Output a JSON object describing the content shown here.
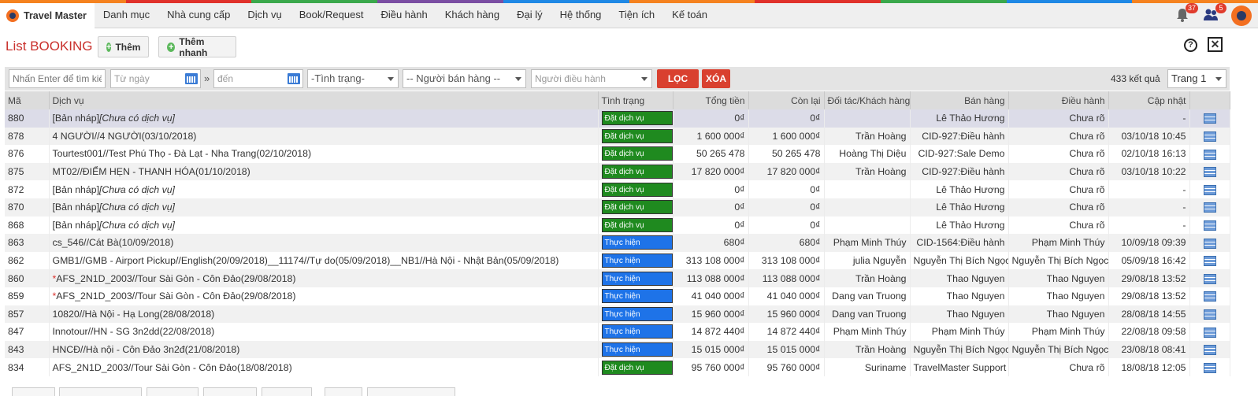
{
  "app": {
    "brand": "Travel Master"
  },
  "nav": [
    "Danh mục",
    "Nhà cung cấp",
    "Dịch vụ",
    "Book/Request",
    "Điều hành",
    "Khách hàng",
    "Đại lý",
    "Hệ thống",
    "Tiện ích",
    "Kế toán"
  ],
  "notifications": {
    "bell_count": "37",
    "users_count": "5"
  },
  "stripe_colors": [
    "#f5821f",
    "#e0312b",
    "#3aa84b",
    "#7b4ea3",
    "#1e88e5",
    "#f5821f",
    "#e0312b",
    "#3aa84b",
    "#1e88e5",
    "#f5821f"
  ],
  "page": {
    "title": "List BOOKING",
    "add_label": "Thêm",
    "quick_add_label": "Thêm nhanh",
    "help": "?",
    "close": "✕"
  },
  "filters": {
    "search_placeholder": "Nhấn Enter để tìm kiếm",
    "from_placeholder": "Từ ngày",
    "range_sep": "»",
    "to_placeholder": "đến",
    "status_select": "-Tình trạng-",
    "seller_select": "-- Người bán hàng --",
    "operator_select": "Người điều hành",
    "filter_button": "LỌC",
    "clear_button": "XÓA",
    "results": "433 kết quả",
    "page_select": "Trang 1"
  },
  "table": {
    "headers": [
      "Mã",
      "Dịch vụ",
      "Tình trạng",
      "Tổng tiền",
      "Còn lại",
      "Đối tác/Khách hàng",
      "Bán hàng",
      "Điều hành",
      "Cập nhật"
    ],
    "rows": [
      {
        "id": "880",
        "service_prefix": "",
        "service": "[Bản nháp]",
        "service_note": "[Chưa có dịch vụ]",
        "status": "Đặt dịch vụ",
        "status_color": "#1f8a1f",
        "total": "0₫",
        "remaining": "0₫",
        "partner": "",
        "seller": "Lê Thảo Hương",
        "operator": "Chưa rõ",
        "updated": "-"
      },
      {
        "id": "878",
        "service_prefix": "",
        "service": "4 NGƯỜI//4 NGƯỜI(03/10/2018)",
        "service_note": "",
        "status": "Đặt dịch vụ",
        "status_color": "#1f8a1f",
        "total": "1 600 000₫",
        "remaining": "1 600 000₫",
        "partner": "Trần Hoàng",
        "seller": "CID-927:Điều hành",
        "operator": "Chưa rõ",
        "updated": "03/10/18 10:45"
      },
      {
        "id": "876",
        "service_prefix": "",
        "service": "Tourtest001//Test Phú Thọ - Đà Lạt - Nha Trang(02/10/2018)",
        "service_note": "",
        "status": "Đặt dịch vụ",
        "status_color": "#1f8a1f",
        "total": "50 265 478",
        "remaining": "50 265 478",
        "partner": "Hoàng Thị Diệu",
        "seller": "CID-927:Sale Demo",
        "operator": "Chưa rõ",
        "updated": "02/10/18 16:13"
      },
      {
        "id": "875",
        "service_prefix": "",
        "service": "MT02//ĐIỂM HẸN - THANH HÓA(01/10/2018)",
        "service_note": "",
        "status": "Đặt dịch vụ",
        "status_color": "#1f8a1f",
        "total": "17 820 000₫",
        "remaining": "17 820 000₫",
        "partner": "Trần Hoàng",
        "seller": "CID-927:Điều hành",
        "operator": "Chưa rõ",
        "updated": "03/10/18 10:22"
      },
      {
        "id": "872",
        "service_prefix": "",
        "service": "[Bản nháp]",
        "service_note": "[Chưa có dịch vụ]",
        "status": "Đặt dịch vụ",
        "status_color": "#1f8a1f",
        "total": "0₫",
        "remaining": "0₫",
        "partner": "",
        "seller": "Lê Thảo Hương",
        "operator": "Chưa rõ",
        "updated": "-"
      },
      {
        "id": "870",
        "service_prefix": "",
        "service": "[Bản nháp]",
        "service_note": "[Chưa có dịch vụ]",
        "status": "Đặt dịch vụ",
        "status_color": "#1f8a1f",
        "total": "0₫",
        "remaining": "0₫",
        "partner": "",
        "seller": "Lê Thảo Hương",
        "operator": "Chưa rõ",
        "updated": "-"
      },
      {
        "id": "868",
        "service_prefix": "",
        "service": "[Bản nháp]",
        "service_note": "[Chưa có dịch vụ]",
        "status": "Đặt dịch vụ",
        "status_color": "#1f8a1f",
        "total": "0₫",
        "remaining": "0₫",
        "partner": "",
        "seller": "Lê Thảo Hương",
        "operator": "Chưa rõ",
        "updated": "-"
      },
      {
        "id": "863",
        "service_prefix": "",
        "service": "cs_546//Cát Bà(10/09/2018)",
        "service_note": "",
        "status": "Thực hiện",
        "status_color": "#1e73e8",
        "total": "680₫",
        "remaining": "680₫",
        "partner": "Phạm Minh Thúy",
        "seller": "CID-1564:Điều hành",
        "operator": "Phạm Minh Thúy",
        "updated": "10/09/18 09:39"
      },
      {
        "id": "862",
        "service_prefix": "",
        "service": "GMB1//GMB - Airport Pickup//English(20/09/2018)__11174//Tự do(05/09/2018)__NB1//Hà Nội - Nhật Bản(05/09/2018)",
        "service_note": "",
        "status": "Thực hiện",
        "status_color": "#1e73e8",
        "total": "313 108 000₫",
        "remaining": "313 108 000₫",
        "partner": "julia Nguyễn",
        "seller": "Nguyễn Thị Bích Ngọc",
        "operator": "Nguyễn Thị Bích Ngọc",
        "updated": "05/09/18 16:42"
      },
      {
        "id": "860",
        "service_prefix": "*",
        "service": "AFS_2N1D_2003//Tour Sài Gòn - Côn Đảo(29/08/2018)",
        "service_note": "",
        "status": "Thực hiện",
        "status_color": "#1e73e8",
        "total": "113 088 000₫",
        "remaining": "113 088 000₫",
        "partner": "Trần Hoàng",
        "seller": "Thao Nguyen",
        "operator": "Thao Nguyen",
        "updated": "29/08/18 13:52"
      },
      {
        "id": "859",
        "service_prefix": "*",
        "service": "AFS_2N1D_2003//Tour Sài Gòn - Côn Đảo(29/08/2018)",
        "service_note": "",
        "status": "Thực hiện",
        "status_color": "#1e73e8",
        "total": "41 040 000₫",
        "remaining": "41 040 000₫",
        "partner": "Dang van Truong",
        "seller": "Thao Nguyen",
        "operator": "Thao Nguyen",
        "updated": "29/08/18 13:52"
      },
      {
        "id": "857",
        "service_prefix": "",
        "service": "10820//Hà Nội - Hạ Long(28/08/2018)",
        "service_note": "",
        "status": "Thực hiện",
        "status_color": "#1e73e8",
        "total": "15 960 000₫",
        "remaining": "15 960 000₫",
        "partner": "Dang van Truong",
        "seller": "Thao Nguyen",
        "operator": "Thao Nguyen",
        "updated": "28/08/18 14:55"
      },
      {
        "id": "847",
        "service_prefix": "",
        "service": "Innotour//HN - SG 3n2dd(22/08/2018)",
        "service_note": "",
        "status": "Thực hiện",
        "status_color": "#1e73e8",
        "total": "14 872 440₫",
        "remaining": "14 872 440₫",
        "partner": "Phạm Minh Thúy",
        "seller": "Phạm Minh Thúy",
        "operator": "Phạm Minh Thúy",
        "updated": "22/08/18 09:58"
      },
      {
        "id": "843",
        "service_prefix": "",
        "service": "HNCĐ//Hà nội - Côn Đảo 3n2đ(21/08/2018)",
        "service_note": "",
        "status": "Thực hiện",
        "status_color": "#1e73e8",
        "total": "15 015 000₫",
        "remaining": "15 015 000₫",
        "partner": "Trần Hoàng",
        "seller": "Nguyễn Thị Bích Ngọc",
        "operator": "Nguyễn Thị Bích Ngọc",
        "updated": "23/08/18 08:41"
      },
      {
        "id": "834",
        "service_prefix": "",
        "service": "AFS_2N1D_2003//Tour Sài Gòn - Côn Đảo(18/08/2018)",
        "service_note": "",
        "status": "Đặt dịch vụ",
        "status_color": "#1f8a1f",
        "total": "95 760 000₫",
        "remaining": "95 760 000₫",
        "partner": "Suriname",
        "seller": "TravelMaster Support",
        "operator": "Chưa rõ",
        "updated": "18/08/18 12:05"
      }
    ]
  }
}
